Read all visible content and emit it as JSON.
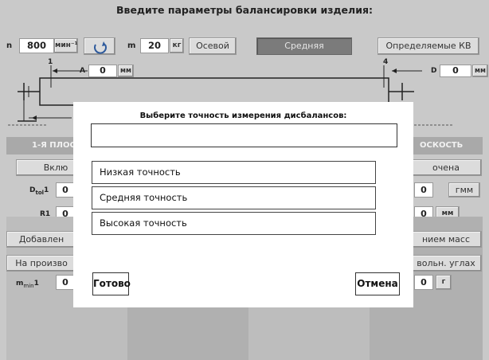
{
  "header": {
    "title": "Введите параметры балансировки изделия:"
  },
  "top": {
    "n_label": "n",
    "n_value": "800",
    "n_unit": "мин⁻¹",
    "rotate_icon": "rotate-ccw-icon",
    "m_label": "m",
    "m_value": "20",
    "m_unit": "кг",
    "axial_label": "Осевой",
    "medium_label": "Средняя",
    "defined_label": "Определяемые КВ"
  },
  "diagram": {
    "plane1": "1",
    "plane4": "4",
    "a_label": "A",
    "a_value": "0",
    "a_unit": "мм",
    "d_label": "D",
    "d_value": "0",
    "d_unit": "мм"
  },
  "left_panel": {
    "plane_title": "1-Я ПЛОС",
    "enable_label": "Вклю",
    "dtol_label": "D",
    "dtol_sub": "tol",
    "dtol_suffix": "1",
    "dtol_value": "0",
    "r_label": "R1",
    "r_value": "0",
    "added_label": "Добавлен",
    "arbitrary_label": "На произво",
    "mmin_label": "m",
    "mmin_sub": "min",
    "mmin_suffix": "1",
    "mmin_value": "0"
  },
  "right_panel": {
    "plane_title": "ОСКОСТЬ",
    "enable_label": "очена",
    "dtol_value": "0",
    "dtol_unit": "гмм",
    "r_value": "0",
    "r_unit": "мм",
    "added_label": "нием масс",
    "arbitrary_label": "вольн. углах",
    "mmin_value": "0",
    "mmin_unit": "г"
  },
  "dialog": {
    "title": "Выберите точность измерения дисбалансов:",
    "field_value": "",
    "options": [
      "Низкая точность",
      "Средняя точность",
      "Высокая точность"
    ],
    "ok_label": "Готово",
    "cancel_label": "Отмена"
  }
}
